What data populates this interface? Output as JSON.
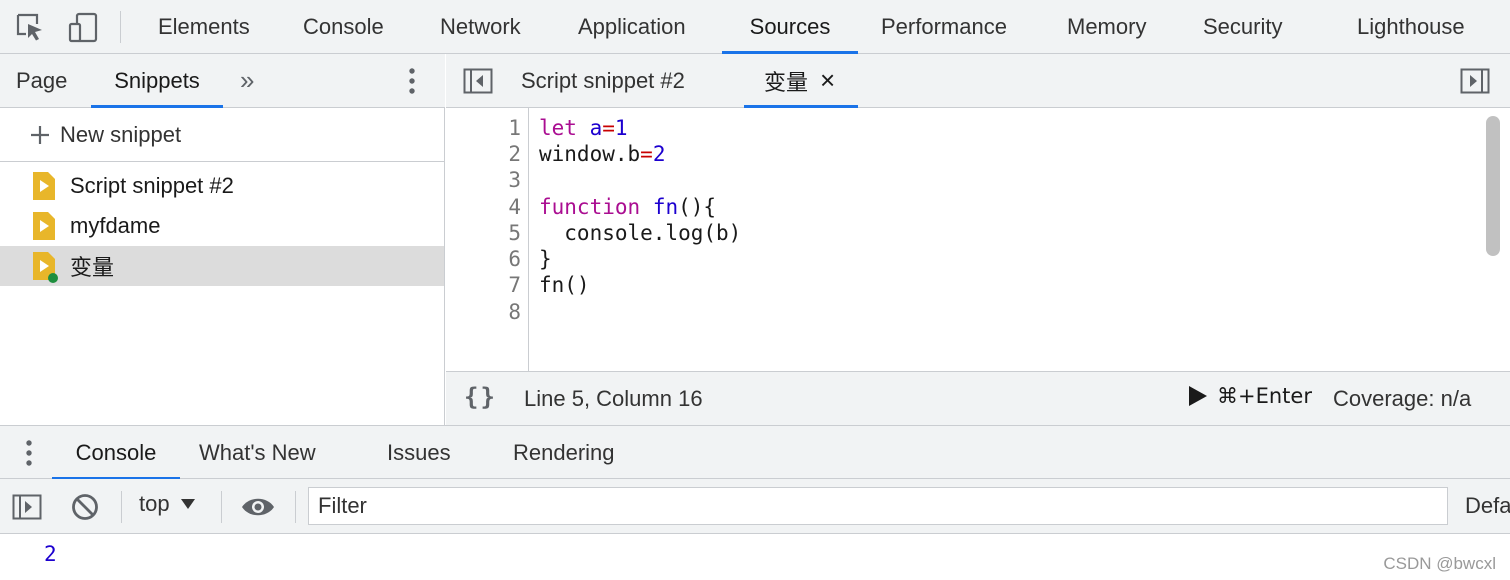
{
  "top_bar": {
    "tabs": [
      "Elements",
      "Console",
      "Network",
      "Application",
      "Sources",
      "Performance",
      "Memory",
      "Security",
      "Lighthouse"
    ],
    "active_tab": "Sources"
  },
  "navigator": {
    "tabs": [
      "Page",
      "Snippets"
    ],
    "active_tab": "Snippets",
    "more_tabs_glyph": "»",
    "new_snippet_label": "New snippet",
    "snippets": [
      {
        "name": "Script snippet #2"
      },
      {
        "name": "myfdame"
      },
      {
        "name": "变量",
        "selected": true,
        "modified_dot": true
      }
    ]
  },
  "editor": {
    "tabs": [
      {
        "label": "Script snippet #2"
      },
      {
        "label": "变量",
        "active": true,
        "close_glyph": "×"
      }
    ],
    "line_numbers": [
      "1",
      "2",
      "3",
      "4",
      "5",
      "6",
      "7",
      "8"
    ],
    "code": {
      "l1_kw": "let",
      "l1_var": "a",
      "l1_op": "=",
      "l1_num": "1",
      "l2_text": "window.b",
      "l2_op": "=",
      "l2_num": "2",
      "l4_kw": "function",
      "l4_fn": "fn",
      "l4_rest": "(){",
      "l5_text": "  console.log(b)",
      "l6_text": "}",
      "l7_text": "fn()"
    },
    "status": {
      "format_glyph": "{}",
      "cursor_position": "Line 5, Column 16",
      "run_shortcut": "⌘+Enter",
      "coverage": "Coverage: n/a"
    }
  },
  "drawer": {
    "tabs": [
      "Console",
      "What's New",
      "Issues",
      "Rendering"
    ],
    "active_tab": "Console",
    "context_selector": "top",
    "filter_placeholder": "Filter",
    "levels_truncated": "Defa",
    "output_lines": [
      "2"
    ]
  },
  "watermark": "CSDN @bwcxl",
  "colors": {
    "accent": "#1a73e8",
    "keyword": "#aa0d91",
    "number": "#1c00cf",
    "snippet_icon": "#e8b62a",
    "modified_dot": "#1e8e3e"
  }
}
